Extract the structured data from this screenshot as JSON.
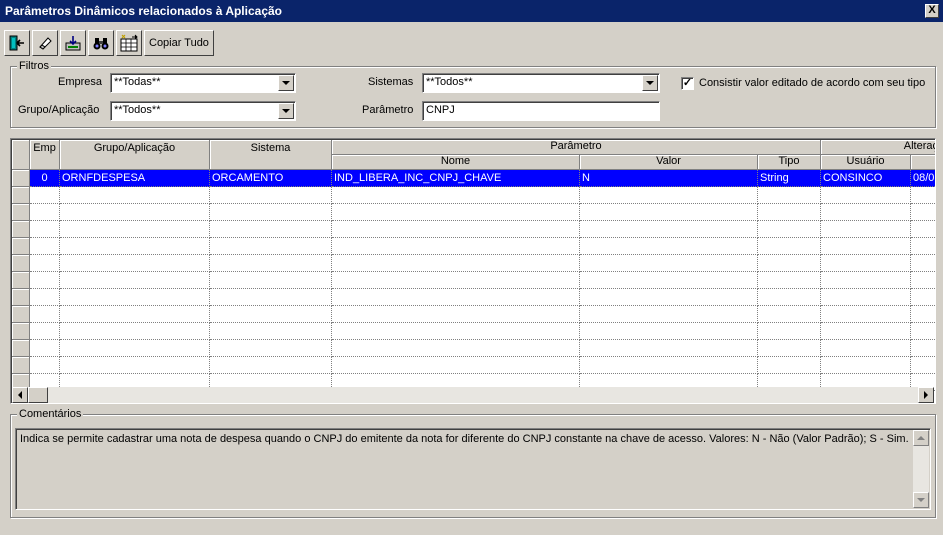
{
  "window": {
    "title": "Parâmetros Dinâmicos relacionados à Aplicação",
    "close_glyph": "X"
  },
  "toolbar": {
    "buttons": [
      {
        "icon": "exit-icon"
      },
      {
        "icon": "eraser-icon"
      },
      {
        "icon": "save-icon"
      },
      {
        "icon": "binoculars-icon"
      },
      {
        "icon": "grid-icon"
      }
    ],
    "copy_label": "Copiar Tudo"
  },
  "filters": {
    "group_label": "Filtros",
    "empresa_label": "Empresa",
    "empresa_value": "**Todas**",
    "grupo_label": "Grupo/Aplicação",
    "grupo_value": "**Todos**",
    "sistemas_label": "Sistemas",
    "sistemas_value": "**Todos**",
    "parametro_label": "Parâmetro",
    "parametro_value": "CNPJ",
    "check_label": "Consistir valor editado de acordo com seu tipo",
    "check_checked": "✓"
  },
  "grid": {
    "headers": {
      "emp": "Emp",
      "grupo": "Grupo/Aplicação",
      "sistema": "Sistema",
      "parametro": "Parâmetro",
      "nome": "Nome",
      "valor": "Valor",
      "tipo": "Tipo",
      "alteracao": "Alteraç",
      "usuario": "Usuário"
    },
    "row": {
      "emp": "0",
      "grupo": "ORNFDESPESA",
      "sistema": "ORCAMENTO",
      "nome": "IND_LIBERA_INC_CNPJ_CHAVE",
      "valor": "N",
      "tipo": "String",
      "usuario": "CONSINCO",
      "data": "08/0"
    }
  },
  "comments": {
    "group_label": "Comentários",
    "text": "Indica se permite cadastrar uma nota de despesa quando o CNPJ do emitente da nota for diferente do CNPJ constante na chave de acesso. Valores: N - Não (Valor Padrão); S - Sim."
  },
  "colors": {
    "title_bg": "#0a246a",
    "selection": "#0000ff",
    "face": "#d4d0c8"
  }
}
